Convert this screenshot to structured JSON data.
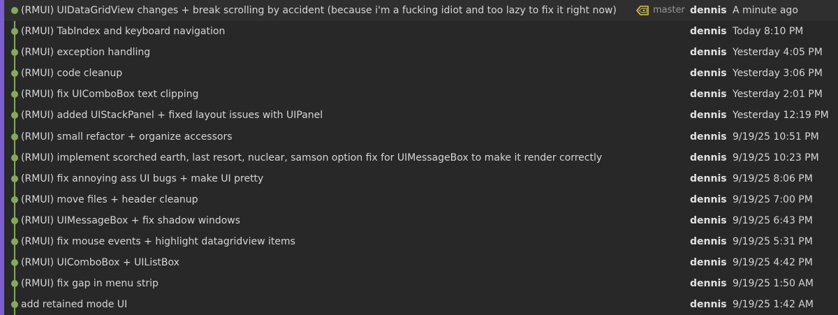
{
  "colors": {
    "background": "#282828",
    "accent_bar": "#7b5fd0",
    "graph": "#86a95c",
    "text": "#d6d6d6",
    "branch_tag": "#f0c040"
  },
  "branch": {
    "name": "master",
    "icon": "tag-icon"
  },
  "commits": [
    {
      "message": "(RMUI) UIDataGridView changes + break scrolling by accident (because i'm a fucking idiot and too lazy to fix it right now)",
      "author": "dennis",
      "date": "A minute ago"
    },
    {
      "message": "(RMUI) TabIndex and keyboard navigation",
      "author": "dennis",
      "date": "Today 8:10 PM"
    },
    {
      "message": "(RMUI) exception handling",
      "author": "dennis",
      "date": "Yesterday 4:05 PM"
    },
    {
      "message": "(RMUI) code cleanup",
      "author": "dennis",
      "date": "Yesterday 3:06 PM"
    },
    {
      "message": "(RMUI) fix UIComboBox text clipping",
      "author": "dennis",
      "date": "Yesterday 2:01 PM"
    },
    {
      "message": "(RMUI) added UIStackPanel + fixed layout issues with UIPanel",
      "author": "dennis",
      "date": "Yesterday 12:19 PM"
    },
    {
      "message": "(RMUI) small refactor + organize accessors",
      "author": "dennis",
      "date": "9/19/25 10:51 PM"
    },
    {
      "message": "(RMUI) implement scorched earth, last resort, nuclear, samson option fix for UIMessageBox to make it render correctly",
      "author": "dennis",
      "date": "9/19/25 10:23 PM"
    },
    {
      "message": "(RMUI) fix annoying ass UI bugs + make UI pretty",
      "author": "dennis",
      "date": "9/19/25 8:06 PM"
    },
    {
      "message": "(RMUI) move files + header cleanup",
      "author": "dennis",
      "date": "9/19/25 7:00 PM"
    },
    {
      "message": "(RMUI) UIMessageBox + fix shadow windows",
      "author": "dennis",
      "date": "9/19/25 6:43 PM"
    },
    {
      "message": "(RMUI) fix mouse events + highlight datagridview items",
      "author": "dennis",
      "date": "9/19/25 5:31 PM"
    },
    {
      "message": "(RMUI) UIComboBox + UIListBox",
      "author": "dennis",
      "date": "9/19/25 4:42 PM"
    },
    {
      "message": "(RMUI) fix gap in menu strip",
      "author": "dennis",
      "date": "9/19/25 1:50 AM"
    },
    {
      "message": "add retained mode UI",
      "author": "dennis",
      "date": "9/19/25 1:42 AM"
    }
  ]
}
